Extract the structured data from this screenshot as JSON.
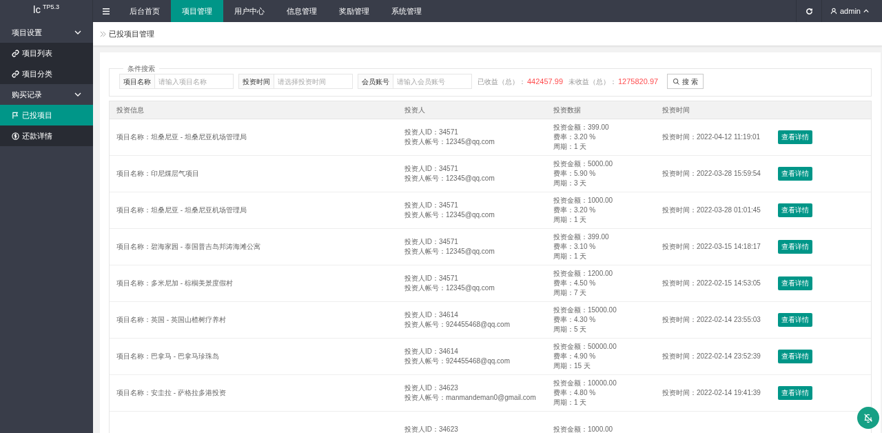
{
  "logo": {
    "text": "lc",
    "version": "TP5.3"
  },
  "topnav": [
    {
      "label": "后台首页",
      "selected": false
    },
    {
      "label": "项目管理",
      "selected": true
    },
    {
      "label": "用户中心",
      "selected": false
    },
    {
      "label": "信息管理",
      "selected": false
    },
    {
      "label": "奖励管理",
      "selected": false
    },
    {
      "label": "系统管理",
      "selected": false
    }
  ],
  "user": {
    "name": "admin"
  },
  "sidebar": [
    {
      "label": "项目设置",
      "expanded": true,
      "children": [
        {
          "label": "项目列表",
          "selected": false
        },
        {
          "label": "项目分类",
          "selected": false
        }
      ]
    },
    {
      "label": "购买记录",
      "expanded": true,
      "children": [
        {
          "label": "已投项目",
          "selected": true
        },
        {
          "label": "还款详情",
          "selected": false
        }
      ]
    }
  ],
  "breadcrumb": "已投项目管理",
  "search": {
    "legend": "条件搜索",
    "fields": [
      {
        "label": "项目名称",
        "placeholder": "请输入项目名称"
      },
      {
        "label": "投资时间",
        "placeholder": "请选择投资时间"
      },
      {
        "label": "会员账号",
        "placeholder": "请输入会员账号"
      }
    ],
    "stats": [
      {
        "label": "已收益（总）：",
        "value": "442457.99"
      },
      {
        "label": "未收益（总）：",
        "value": "1275820.97"
      }
    ],
    "button": "搜 索"
  },
  "table": {
    "columns": [
      "投资信息",
      "投资人",
      "投资数据",
      "投资时间"
    ],
    "rows": [
      {
        "project": "项目名称：坦桑尼亚 - 坦桑尼亚机场管理局",
        "investor": [
          "投资人ID：34571",
          "投资人帐号：12345@qq.com"
        ],
        "data": [
          "投资金额：399.00",
          "费率：3.20 %",
          "周期：1 天"
        ],
        "time": "投资时间：2022-04-12 11:19:01",
        "action": "查看详情"
      },
      {
        "project": "项目名称：印尼煤层气项目",
        "investor": [
          "投资人ID：34571",
          "投资人帐号：12345@qq.com"
        ],
        "data": [
          "投资金额：5000.00",
          "费率：5.90 %",
          "周期：3 天"
        ],
        "time": "投资时间：2022-03-28 15:59:54",
        "action": "查看详情"
      },
      {
        "project": "项目名称：坦桑尼亚 - 坦桑尼亚机场管理局",
        "investor": [
          "投资人ID：34571",
          "投资人帐号：12345@qq.com"
        ],
        "data": [
          "投资金额：1000.00",
          "费率：3.20 %",
          "周期：1 天"
        ],
        "time": "投资时间：2022-03-28 01:01:45",
        "action": "查看详情"
      },
      {
        "project": "项目名称：碧海家园 - 泰国普吉岛邦涛海滩公寓",
        "investor": [
          "投资人ID：34571",
          "投资人帐号：12345@qq.com"
        ],
        "data": [
          "投资金额：399.00",
          "费率：3.10 %",
          "周期：1 天"
        ],
        "time": "投资时间：2022-03-15 14:18:17",
        "action": "查看详情"
      },
      {
        "project": "项目名称：多米尼加 - 棕榈美景度假村",
        "investor": [
          "投资人ID：34571",
          "投资人帐号：12345@qq.com"
        ],
        "data": [
          "投资金额：1200.00",
          "费率：4.50 %",
          "周期：7 天"
        ],
        "time": "投资时间：2022-02-15 14:53:05",
        "action": "查看详情"
      },
      {
        "project": "项目名称：英国 - 英国山楂树疗养村",
        "investor": [
          "投资人ID：34614",
          "投资人帐号：924455468@qq.com"
        ],
        "data": [
          "投资金额：15000.00",
          "费率：4.30 %",
          "周期：5 天"
        ],
        "time": "投资时间：2022-02-14 23:55:03",
        "action": "查看详情"
      },
      {
        "project": "项目名称：巴拿马 - 巴拿马珍珠岛",
        "investor": [
          "投资人ID：34614",
          "投资人帐号：924455468@qq.com"
        ],
        "data": [
          "投资金额：50000.00",
          "费率：4.90 %",
          "周期：15 天"
        ],
        "time": "投资时间：2022-02-14 23:52:39",
        "action": "查看详情"
      },
      {
        "project": "项目名称：安圭拉 - 萨格拉多港投资",
        "investor": [
          "投资人ID：34623",
          "投资人帐号：manmandeman0@gmail.com"
        ],
        "data": [
          "投资金额：10000.00",
          "费率：4.80 %",
          "周期：1 天"
        ],
        "time": "投资时间：2022-02-14 19:41:39",
        "action": "查看详情"
      },
      {
        "investor": [
          "投资人ID：34623"
        ],
        "data": [
          "投资金额：1000.00"
        ]
      }
    ]
  }
}
